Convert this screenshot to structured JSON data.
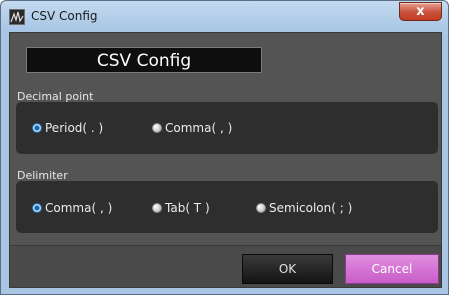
{
  "window": {
    "title": "CSV Config",
    "close_glyph": "x"
  },
  "header": {
    "title": "CSV Config"
  },
  "decimal_point": {
    "label": "Decimal point",
    "options": [
      {
        "label": "Period( . )",
        "selected": true
      },
      {
        "label": "Comma( , )",
        "selected": false
      }
    ]
  },
  "delimiter": {
    "label": "Delimiter",
    "options": [
      {
        "label": "Comma( , )",
        "selected": true
      },
      {
        "label": "Tab( T )",
        "selected": false
      },
      {
        "label": "Semicolon( ; )",
        "selected": false
      }
    ]
  },
  "buttons": {
    "ok": "OK",
    "cancel": "Cancel"
  },
  "colors": {
    "dialog_bg": "#545454",
    "group_bg": "#2e2e2e",
    "cancel_accent": "#c95cc9",
    "radio_selected": "#2a6fb5"
  },
  "icons": {
    "app": "waveform-app-icon",
    "close": "close-icon"
  }
}
